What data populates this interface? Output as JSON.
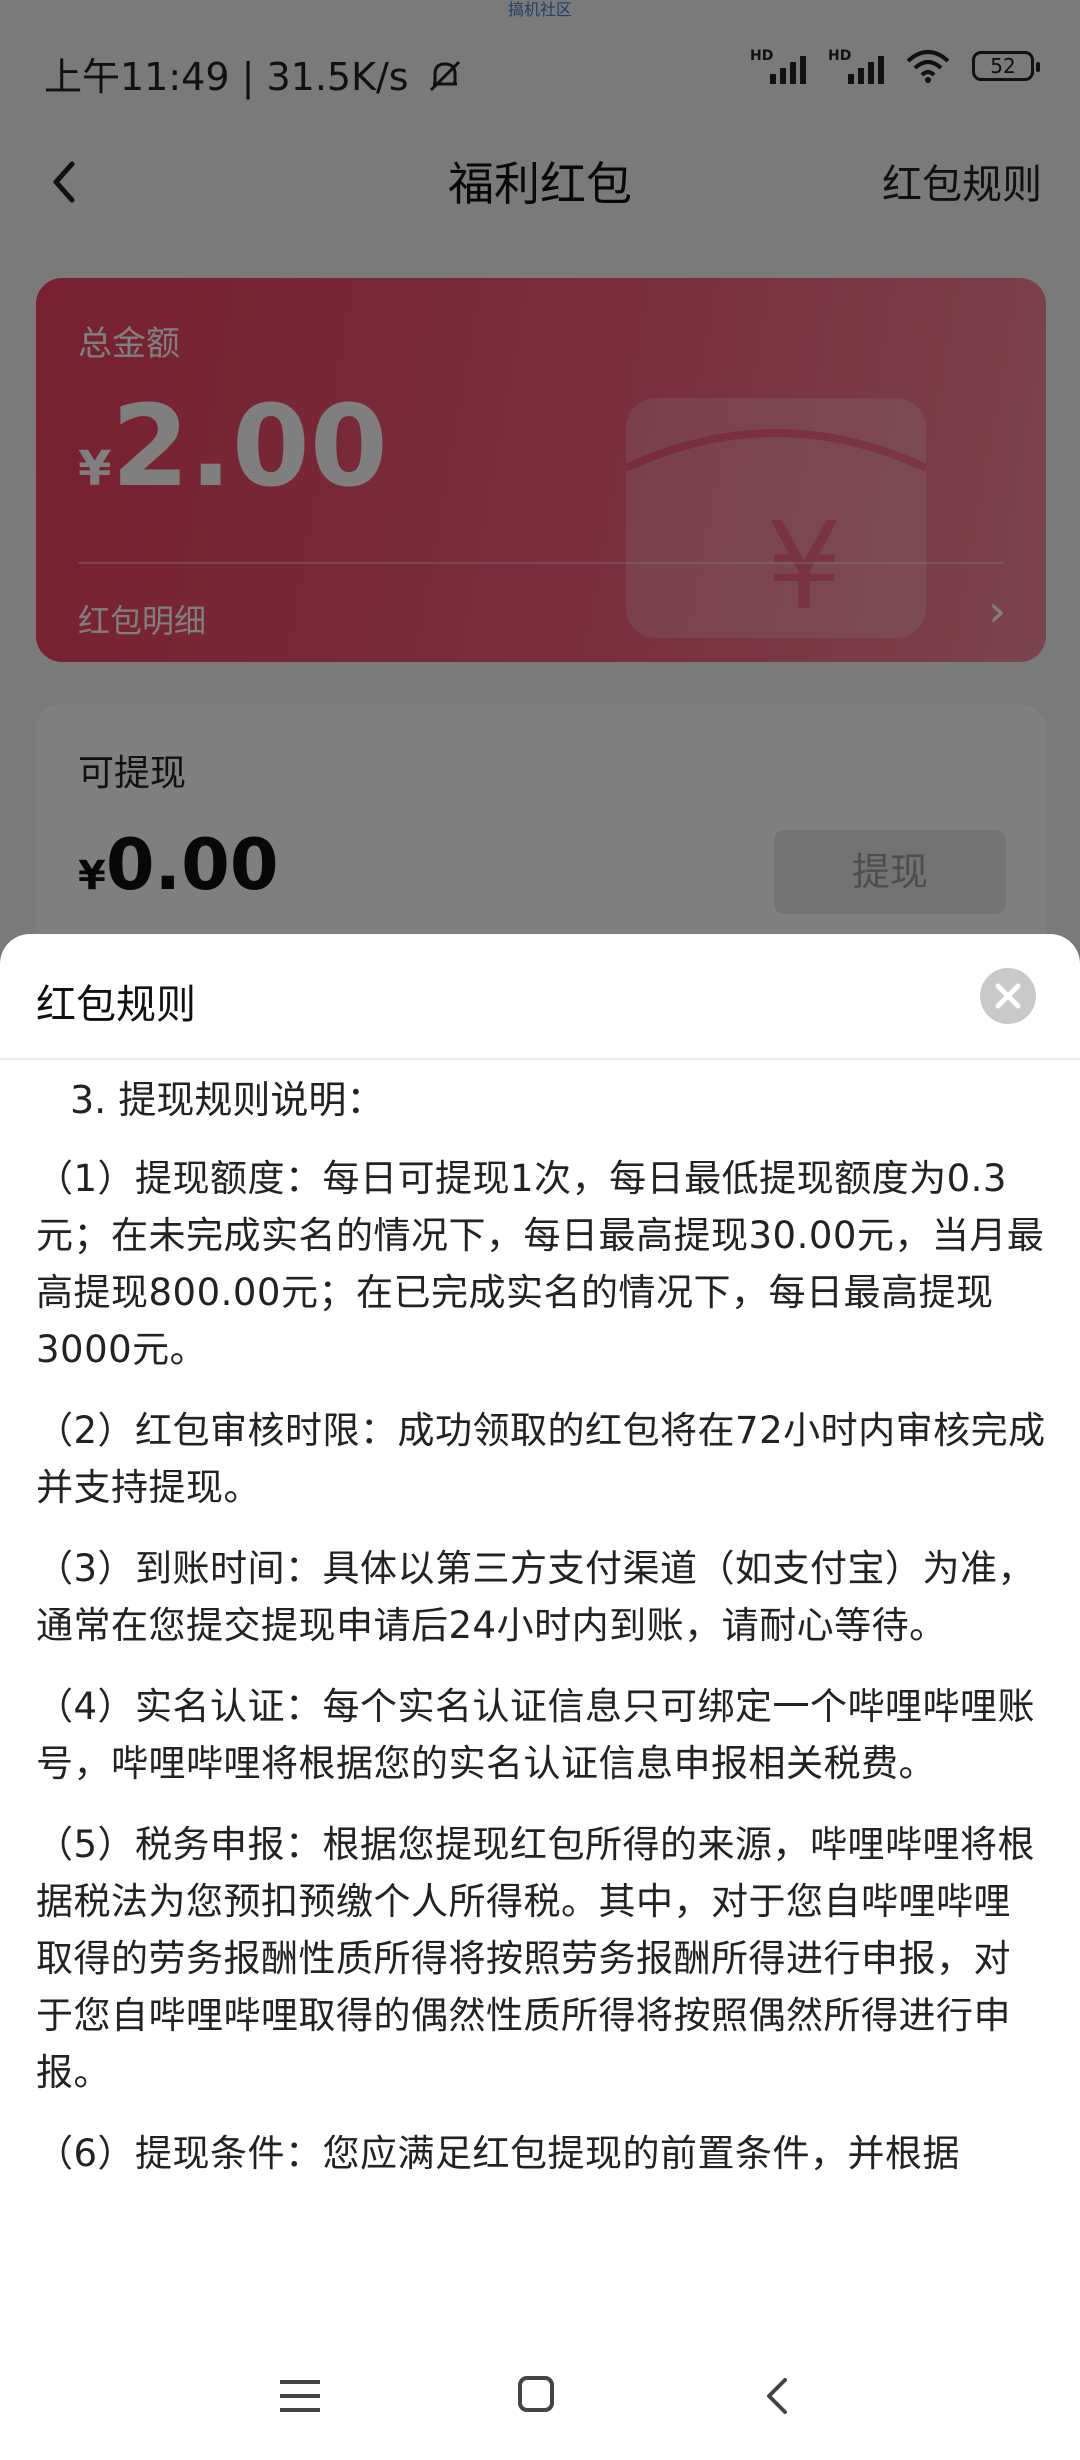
{
  "watermark": "搞机社区",
  "status_bar": {
    "time_speed": "上午11:49 | 31.5K/s",
    "mute_icon": "bell-off-icon",
    "signal_badge": "HD",
    "battery": "52"
  },
  "header": {
    "back_icon": "chevron-left-icon",
    "title": "福利红包",
    "rules_link": "红包规则"
  },
  "total_card": {
    "label": "总金额",
    "currency": "¥",
    "amount": "2.00",
    "detail_link": "红包明细",
    "accent_color": "#f0405f"
  },
  "withdraw_card": {
    "label": "可提现",
    "currency": "¥",
    "amount": "0.00",
    "button_label": "提现"
  },
  "rules_sheet": {
    "title": "红包规则",
    "close_icon": "close-icon",
    "heading": "3. 提现规则说明：",
    "paragraphs": [
      "（1）提现额度：每日可提现1次，每日最低提现额度为0.3元；在未完成实名的情况下，每日最高提现30.00元，当月最高提现800.00元；在已完成实名的情况下，每日最高提现3000元。",
      "（2）红包审核时限：成功领取的红包将在72小时内审核完成并支持提现。",
      "（3）到账时间：具体以第三方支付渠道（如支付宝）为准，通常在您提交提现申请后24小时内到账，请耐心等待。",
      "（4）实名认证：每个实名认证信息只可绑定一个哔哩哔哩账号，哔哩哔哩将根据您的实名认证信息申报相关税费。",
      "（5）税务申报：根据您提现红包所得的来源，哔哩哔哩将根据税法为您预扣预缴个人所得税。其中，对于您自哔哩哔哩取得的劳务报酬性质所得将按照劳务报酬所得进行申报，对于您自哔哩哔哩取得的偶然性质所得将按照偶然所得进行申报。",
      "（6）提现条件：您应满足红包提现的前置条件，并根据"
    ]
  },
  "nav_bar": {
    "menu_icon": "menu-icon",
    "home_icon": "home-icon",
    "back_icon": "back-icon"
  }
}
